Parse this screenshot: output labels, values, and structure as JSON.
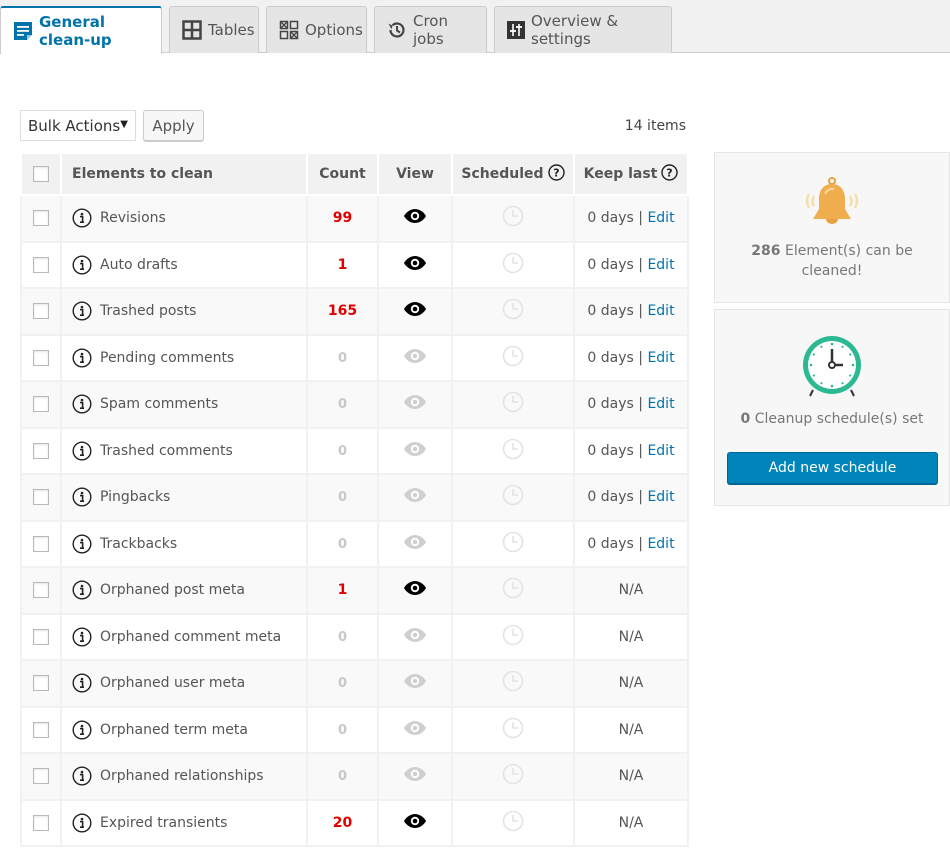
{
  "tabs": [
    {
      "label": "General clean-up",
      "icon": "document-list-icon",
      "active": true
    },
    {
      "label": "Tables",
      "icon": "table-grid-icon",
      "active": false
    },
    {
      "label": "Options",
      "icon": "options-grid-icon",
      "active": false
    },
    {
      "label": "Cron jobs",
      "icon": "history-clock-icon",
      "active": false
    },
    {
      "label": "Overview & settings",
      "icon": "sliders-icon",
      "active": false
    }
  ],
  "toolbar": {
    "bulk_actions": "Bulk Actions",
    "apply_label": "Apply",
    "items_count": "14 items"
  },
  "table": {
    "headers": {
      "elements": "Elements to clean",
      "count": "Count",
      "view": "View",
      "scheduled": "Scheduled",
      "keep_last": "Keep last"
    },
    "rows": [
      {
        "name": "Revisions",
        "count": "99",
        "active": true,
        "keep": "0 days",
        "edit": "Edit"
      },
      {
        "name": "Auto drafts",
        "count": "1",
        "active": true,
        "keep": "0 days",
        "edit": "Edit"
      },
      {
        "name": "Trashed posts",
        "count": "165",
        "active": true,
        "keep": "0 days",
        "edit": "Edit"
      },
      {
        "name": "Pending comments",
        "count": "0",
        "active": false,
        "keep": "0 days",
        "edit": "Edit"
      },
      {
        "name": "Spam comments",
        "count": "0",
        "active": false,
        "keep": "0 days",
        "edit": "Edit"
      },
      {
        "name": "Trashed comments",
        "count": "0",
        "active": false,
        "keep": "0 days",
        "edit": "Edit"
      },
      {
        "name": "Pingbacks",
        "count": "0",
        "active": false,
        "keep": "0 days",
        "edit": "Edit"
      },
      {
        "name": "Trackbacks",
        "count": "0",
        "active": false,
        "keep": "0 days",
        "edit": "Edit"
      },
      {
        "name": "Orphaned post meta",
        "count": "1",
        "active": true,
        "keep": "N/A",
        "edit": null
      },
      {
        "name": "Orphaned comment meta",
        "count": "0",
        "active": false,
        "keep": "N/A",
        "edit": null
      },
      {
        "name": "Orphaned user meta",
        "count": "0",
        "active": false,
        "keep": "N/A",
        "edit": null
      },
      {
        "name": "Orphaned term meta",
        "count": "0",
        "active": false,
        "keep": "N/A",
        "edit": null
      },
      {
        "name": "Orphaned relationships",
        "count": "0",
        "active": false,
        "keep": "N/A",
        "edit": null
      },
      {
        "name": "Expired transients",
        "count": "20",
        "active": true,
        "keep": "N/A",
        "edit": null
      }
    ]
  },
  "sidebar": {
    "cleanable": {
      "count": "286",
      "text": "Element(s) can be cleaned!"
    },
    "schedules": {
      "count": "0",
      "text": "Cleanup schedule(s) set",
      "button_label": "Add new schedule"
    }
  },
  "colors": {
    "accent": "#0073aa",
    "active_count": "#e00000",
    "bell": "#f0ad4e",
    "clock": "#2bb893",
    "button": "#0085ba"
  }
}
